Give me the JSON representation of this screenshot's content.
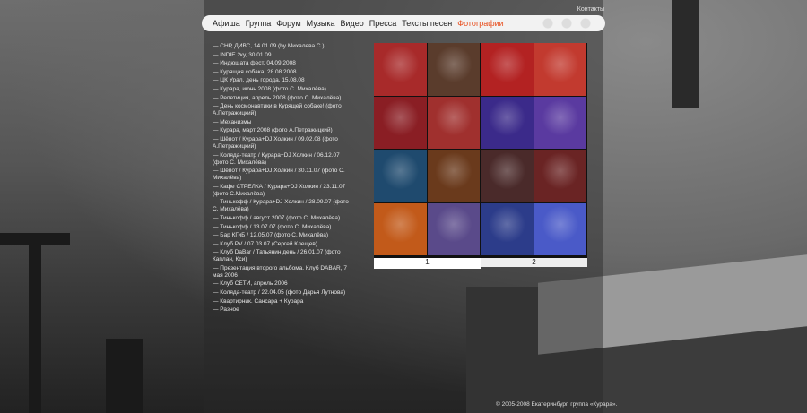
{
  "header": {
    "contacts_label": "Контакты"
  },
  "menu": [
    {
      "label": "Афиша",
      "active": false
    },
    {
      "label": "Группа",
      "active": false
    },
    {
      "label": "Форум",
      "active": false
    },
    {
      "label": "Музыка",
      "active": false
    },
    {
      "label": "Видео",
      "active": false
    },
    {
      "label": "Пресса",
      "active": false
    },
    {
      "label": "Тексты песен",
      "active": false
    },
    {
      "label": "Фотографии",
      "active": true
    }
  ],
  "albums": [
    "— СНР, ДИВС, 14.01.09 (by Михалева С.)",
    "— INDIE 2ку, 30.01.09",
    "— Индюшата фест, 04.09.2008",
    "— Курящая собака, 28.08.2008",
    "— ЦК Урал, день города, 15.08.08",
    "— Курара, июнь 2008 (фото С. Михалёва)",
    "— Репетиция, апрель 2008 (фото С. Михалёва)",
    "— День космонавтики в Курящей собаке! (фото А.Петражицкий)",
    "— Механизмы",
    "— Курара, март 2008 (фото А.Петражицкий)",
    "— Шёпот / Курара+DJ Холкин / 09.02.08 (фото А.Петражицкий)",
    "— Коляда-театр / Курара+DJ Холкин / 06.12.07 (фото С. Михалёва)",
    "— Шёпот / Курара+DJ Холкин / 30.11.07 (фото С. Михалёва)",
    "— Кафе СТРЕЛКА / Курара+DJ Холкин / 23.11.07 (фото С.Михалёва)",
    "— Тинькофф / Курара+DJ Холкин / 28.09.07 (фото С. Михалёва)",
    "— Тинькофф / август 2007 (фото С. Михалёва)",
    "— Тинькофф / 13.07.07 (фото С. Михалёва)",
    "— Бар КГиБ / 12.05.07 (фото С. Михалёва)",
    "— Клуб PV / 07.03.07 (Сергей Клещев)",
    "— Клуб DaBar / Татьянин день / 26.01.07 (фото Каплан, Кси)",
    "— Презентация второго альбома. Клуб DABAR, 7 мая 2006",
    "— Клуб СЕТИ, апрель 2006",
    "— Коляда-театр / 22.04.05 (фото Дарья Лутнова)",
    "— Квартирник. Сансара + Курара",
    "— Разное"
  ],
  "photos": [
    {
      "color": "#a82a2a"
    },
    {
      "color": "#5a3c2c"
    },
    {
      "color": "#b32222"
    },
    {
      "color": "#c23a2f"
    },
    {
      "color": "#8a1e24"
    },
    {
      "color": "#a0302e"
    },
    {
      "color": "#3b2a8a"
    },
    {
      "color": "#5a3aa0"
    },
    {
      "color": "#1f4a6e"
    },
    {
      "color": "#6a3a1c"
    },
    {
      "color": "#4a2a2a"
    },
    {
      "color": "#6a2424"
    },
    {
      "color": "#c25a1a"
    },
    {
      "color": "#5a4a8a"
    },
    {
      "color": "#2c3c8a"
    },
    {
      "color": "#4a5ac8"
    }
  ],
  "pager": {
    "page1": "1",
    "page2": "2"
  },
  "footer": {
    "copyright": "© 2005-2008 Екатеринбург, группа «Курара»."
  }
}
